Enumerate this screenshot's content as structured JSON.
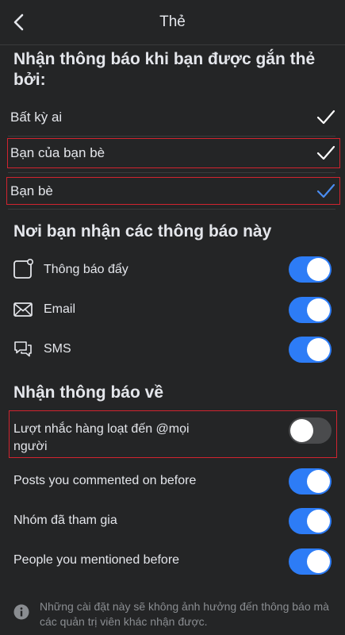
{
  "header": {
    "title": "Thẻ"
  },
  "tagged_by": {
    "title": "Nhận thông báo khi bạn được gắn thẻ bởi:",
    "options": [
      {
        "label": "Bất kỳ ai",
        "check_color": "#ffffff"
      },
      {
        "label": "Bạn của bạn bè",
        "check_color": "#ffffff"
      },
      {
        "label": "Bạn bè",
        "check_color": "#4a8cf0"
      }
    ]
  },
  "channels": {
    "title": "Nơi bạn nhận các thông báo này",
    "items": [
      {
        "label": "Thông báo đẩy",
        "icon": "push-notification-icon",
        "enabled": true
      },
      {
        "label": "Email",
        "icon": "envelope-icon",
        "enabled": true
      },
      {
        "label": "SMS",
        "icon": "chat-bubbles-icon",
        "enabled": true
      }
    ]
  },
  "notify_about": {
    "title": "Nhận thông báo về",
    "items": [
      {
        "label_line1": "Lượt nhắc hàng loạt đến @mọi",
        "label_line2": "người",
        "enabled": false
      },
      {
        "label": "Posts you commented on before",
        "enabled": true
      },
      {
        "label": "Nhóm đã tham gia",
        "enabled": true
      },
      {
        "label": "People you mentioned before",
        "enabled": true
      }
    ]
  },
  "footer": {
    "note_line1": "Những cài đặt này sẽ không ảnh hưởng đến thông báo mà",
    "note_line2": "các quản trị viên khác nhận được.",
    "icon": "info-icon"
  },
  "colors": {
    "background": "#242526",
    "toggle_on": "#2d7cf6",
    "toggle_off": "#4a4b4d",
    "highlight_box": "#d0242f"
  }
}
